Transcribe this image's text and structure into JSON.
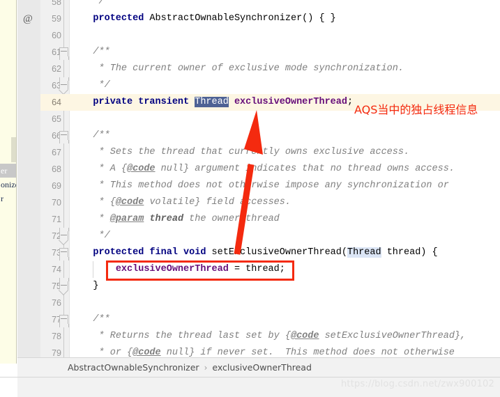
{
  "editor": {
    "first_line_number": 58,
    "current_line": 64,
    "at_marker": "@",
    "lines": [
      {
        "num": 58,
        "indent": 0,
        "tokens": [
          {
            "t": "    ",
            "c": "plain"
          },
          {
            "t": "*/",
            "c": "cmt"
          }
        ]
      },
      {
        "num": 59,
        "indent": 0,
        "annot": "@",
        "tokens": [
          {
            "t": "    ",
            "c": "plain"
          },
          {
            "t": "protected",
            "c": "kw"
          },
          {
            "t": " AbstractOwnableSynchronizer() { }",
            "c": "type"
          }
        ]
      },
      {
        "num": 60,
        "indent": 0,
        "tokens": []
      },
      {
        "num": 61,
        "indent": 0,
        "fold": "start",
        "tokens": [
          {
            "t": "    ",
            "c": "plain"
          },
          {
            "t": "/**",
            "c": "cmt"
          }
        ]
      },
      {
        "num": 62,
        "indent": 0,
        "tokens": [
          {
            "t": "     ",
            "c": "plain"
          },
          {
            "t": "* The current owner of exclusive mode synchronization.",
            "c": "cmt"
          }
        ]
      },
      {
        "num": 63,
        "indent": 0,
        "fold": "end",
        "tokens": [
          {
            "t": "     ",
            "c": "plain"
          },
          {
            "t": "*/",
            "c": "cmt"
          }
        ]
      },
      {
        "num": 64,
        "indent": 0,
        "current": true,
        "tokens": [
          {
            "t": "    ",
            "c": "plain"
          },
          {
            "t": "private transient ",
            "c": "kw"
          },
          {
            "t": "Thread",
            "c": "sel"
          },
          {
            "t": " ",
            "c": "plain"
          },
          {
            "t": "exclusiveOwnerThread",
            "c": "field"
          },
          {
            "t": ";",
            "c": "type"
          }
        ]
      },
      {
        "num": 65,
        "indent": 0,
        "tokens": []
      },
      {
        "num": 66,
        "indent": 0,
        "fold": "start",
        "tokens": [
          {
            "t": "    ",
            "c": "plain"
          },
          {
            "t": "/**",
            "c": "cmt"
          }
        ]
      },
      {
        "num": 67,
        "indent": 0,
        "tokens": [
          {
            "t": "     ",
            "c": "plain"
          },
          {
            "t": "* Sets the thread that currently owns exclusive access.",
            "c": "cmt"
          }
        ]
      },
      {
        "num": 68,
        "indent": 0,
        "tokens": [
          {
            "t": "     ",
            "c": "plain"
          },
          {
            "t": "* A {",
            "c": "cmt"
          },
          {
            "t": "@code",
            "c": "tag"
          },
          {
            "t": " null} argument indicates that no thread owns access.",
            "c": "cmt"
          }
        ]
      },
      {
        "num": 69,
        "indent": 0,
        "tokens": [
          {
            "t": "     ",
            "c": "plain"
          },
          {
            "t": "* This method does not otherwise impose any synchronization or",
            "c": "cmt"
          }
        ]
      },
      {
        "num": 70,
        "indent": 0,
        "tokens": [
          {
            "t": "     ",
            "c": "plain"
          },
          {
            "t": "* {",
            "c": "cmt"
          },
          {
            "t": "@code",
            "c": "tag"
          },
          {
            "t": " volatile} field accesses.",
            "c": "cmt"
          }
        ]
      },
      {
        "num": 71,
        "indent": 0,
        "tokens": [
          {
            "t": "     ",
            "c": "plain"
          },
          {
            "t": "* ",
            "c": "cmt"
          },
          {
            "t": "@param",
            "c": "tag"
          },
          {
            "t": " ",
            "c": "cmt"
          },
          {
            "t": "thread",
            "c": "tagb"
          },
          {
            "t": " the owner thread",
            "c": "cmt"
          }
        ]
      },
      {
        "num": 72,
        "indent": 0,
        "fold": "end",
        "tokens": [
          {
            "t": "     ",
            "c": "plain"
          },
          {
            "t": "*/",
            "c": "cmt"
          }
        ]
      },
      {
        "num": 73,
        "indent": 0,
        "fold": "start",
        "tokens": [
          {
            "t": "    ",
            "c": "plain"
          },
          {
            "t": "protected final void ",
            "c": "kw"
          },
          {
            "t": "setExclusiveOwnerThread(",
            "c": "type"
          },
          {
            "t": "Thread",
            "c": "occ"
          },
          {
            "t": " thread) {",
            "c": "type"
          }
        ]
      },
      {
        "num": 74,
        "indent": 1,
        "tokens": [
          {
            "t": "        ",
            "c": "plain"
          },
          {
            "t": "exclusiveOwnerThread",
            "c": "field"
          },
          {
            "t": " = thread;",
            "c": "type"
          }
        ]
      },
      {
        "num": 75,
        "indent": 0,
        "fold": "end",
        "tokens": [
          {
            "t": "    ",
            "c": "plain"
          },
          {
            "t": "}",
            "c": "type"
          }
        ]
      },
      {
        "num": 76,
        "indent": 0,
        "tokens": []
      },
      {
        "num": 77,
        "indent": 0,
        "fold": "start",
        "tokens": [
          {
            "t": "    ",
            "c": "plain"
          },
          {
            "t": "/**",
            "c": "cmt"
          }
        ]
      },
      {
        "num": 78,
        "indent": 0,
        "tokens": [
          {
            "t": "     ",
            "c": "plain"
          },
          {
            "t": "* Returns the thread last set by {",
            "c": "cmt"
          },
          {
            "t": "@code",
            "c": "tag"
          },
          {
            "t": " setExclusiveOwnerThread},",
            "c": "cmt"
          }
        ]
      },
      {
        "num": 79,
        "indent": 0,
        "tokens": [
          {
            "t": "     ",
            "c": "plain"
          },
          {
            "t": "* or {",
            "c": "cmt"
          },
          {
            "t": "@code",
            "c": "tag"
          },
          {
            "t": " null} if never set.  This method does not otherwise",
            "c": "cmt"
          }
        ]
      }
    ]
  },
  "popup": {
    "rows": [
      {
        "label": "er",
        "selected": true
      },
      {
        "label": "onize",
        "selected": false
      },
      {
        "label": "r",
        "selected": false
      }
    ]
  },
  "annotations": {
    "note_text": "AQS当中的独占线程信息",
    "note_color": "#f42a0f",
    "highlight_box_color": "#f42a0f",
    "arrow_color": "#f42a0f"
  },
  "breadcrumb": {
    "items": [
      "AbstractOwnableSynchronizer",
      "exclusiveOwnerThread"
    ],
    "separator": "›"
  },
  "watermark": {
    "text": "https://blog.csdn.net/zwx900102"
  }
}
